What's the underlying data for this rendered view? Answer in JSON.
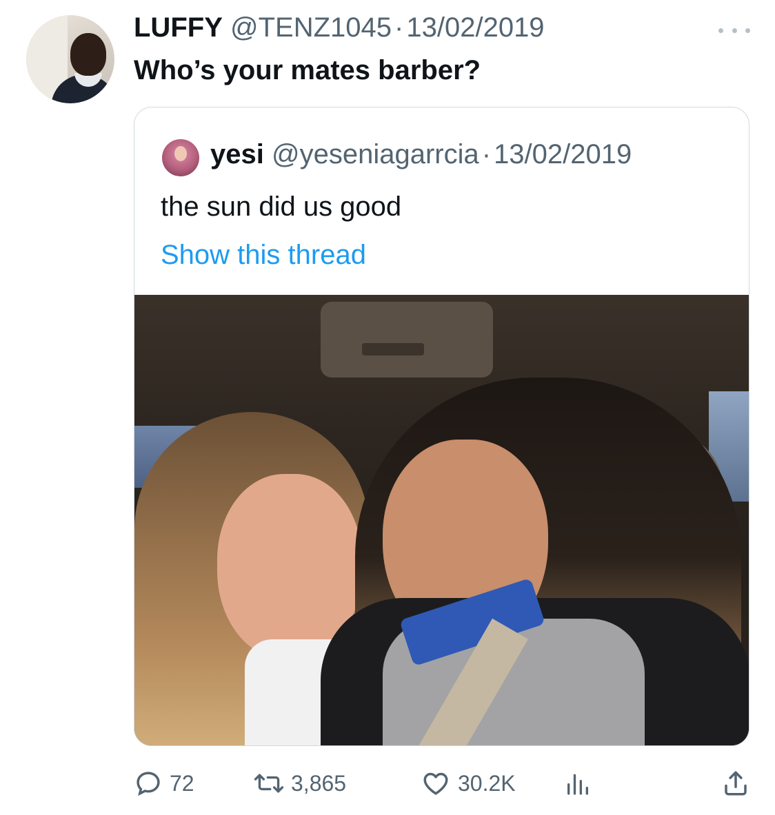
{
  "tweet": {
    "author": {
      "display_name": "LUFFY",
      "handle": "@TENZ1045",
      "date": "13/02/2019",
      "separator": "·"
    },
    "text": "Who’s your mates barber?",
    "menu_icon": "more-horizontal-icon"
  },
  "quoted_tweet": {
    "author": {
      "display_name": "yesi",
      "handle": "@yeseniagarrcia",
      "date": "13/02/2019",
      "separator": "·"
    },
    "text": "the sun did us good",
    "thread_link": "Show this thread",
    "link_color": "#1d9bf0"
  },
  "actions": {
    "reply": {
      "icon": "reply-icon",
      "count": "72"
    },
    "retweet": {
      "icon": "retweet-icon",
      "count": "3,865"
    },
    "like": {
      "icon": "heart-icon",
      "count": "30.2K"
    },
    "views": {
      "icon": "bar-chart-icon"
    },
    "share": {
      "icon": "share-icon"
    }
  },
  "colors": {
    "text_primary": "#0f1419",
    "text_secondary": "#536471",
    "border": "#cfd9de",
    "link": "#1d9bf0"
  }
}
